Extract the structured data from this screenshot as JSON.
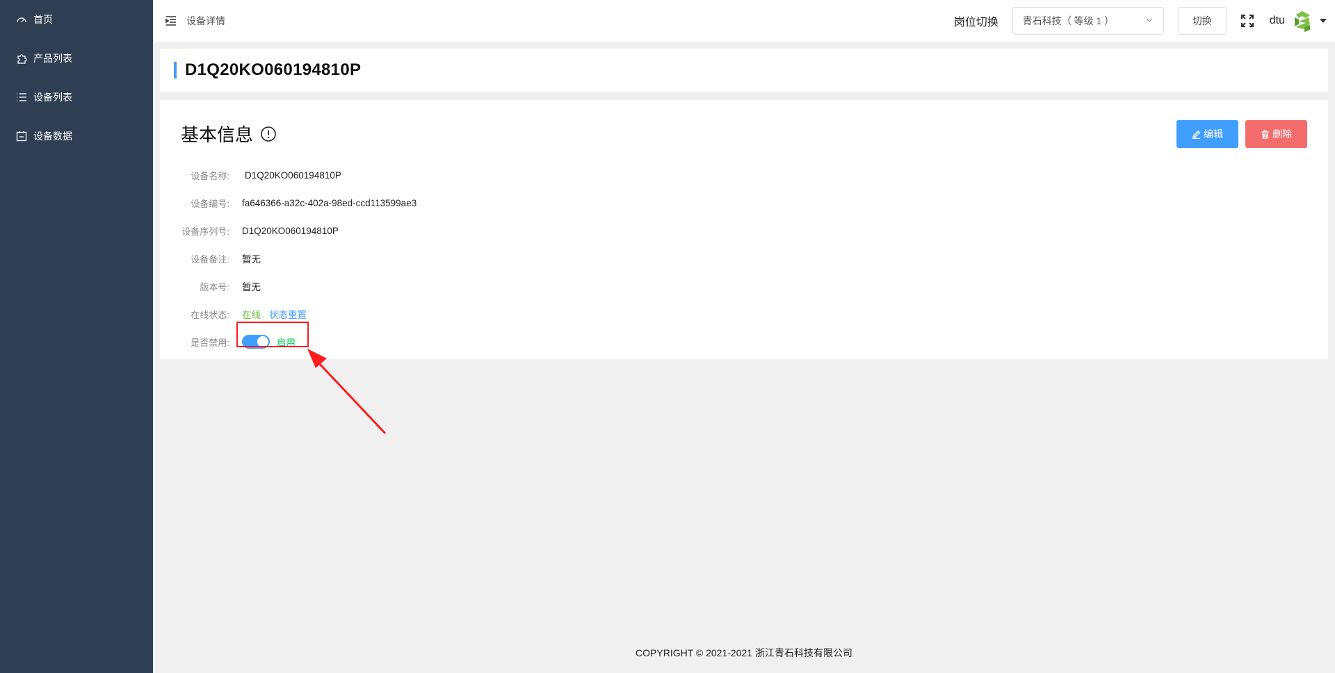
{
  "sidebar": {
    "items": [
      {
        "label": "首页",
        "icon": "dashboard-icon"
      },
      {
        "label": "产品列表",
        "icon": "puzzle-icon"
      },
      {
        "label": "设备列表",
        "icon": "list-icon"
      },
      {
        "label": "设备数据",
        "icon": "calendar-icon"
      }
    ]
  },
  "header": {
    "breadcrumb": "设备详情",
    "switch_label": "岗位切换",
    "select_value": "青石科技（ 等级 1 ）",
    "switch_button": "切换",
    "user": "dtu"
  },
  "page": {
    "title": "D1Q20KO060194810P"
  },
  "card": {
    "title": "基本信息",
    "edit_label": "编辑",
    "delete_label": "删除",
    "fields": {
      "name_label": "设备名称:",
      "name_value": "D1Q20KO060194810P",
      "id_label": "设备编号:",
      "id_value": "fa646366-a32c-402a-98ed-ccd113599ae3",
      "serial_label": "设备序列号:",
      "serial_value": "D1Q20KO060194810P",
      "remark_label": "设备备注:",
      "remark_value": "暂无",
      "version_label": "版本号:",
      "version_value": "暂无",
      "status_label": "在线状态:",
      "status_value": "在线",
      "status_reset": "状态重置",
      "disabled_label": "是否禁用:",
      "disabled_value": "启用"
    }
  },
  "footer": {
    "copyright": "COPYRIGHT © 2021-2021 浙江青石科技有限公司"
  },
  "colors": {
    "sidebar_bg": "#2f3e52",
    "primary": "#409eff",
    "danger": "#f56c6c",
    "success": "#67c23a",
    "annotation": "#ff1c1c"
  }
}
